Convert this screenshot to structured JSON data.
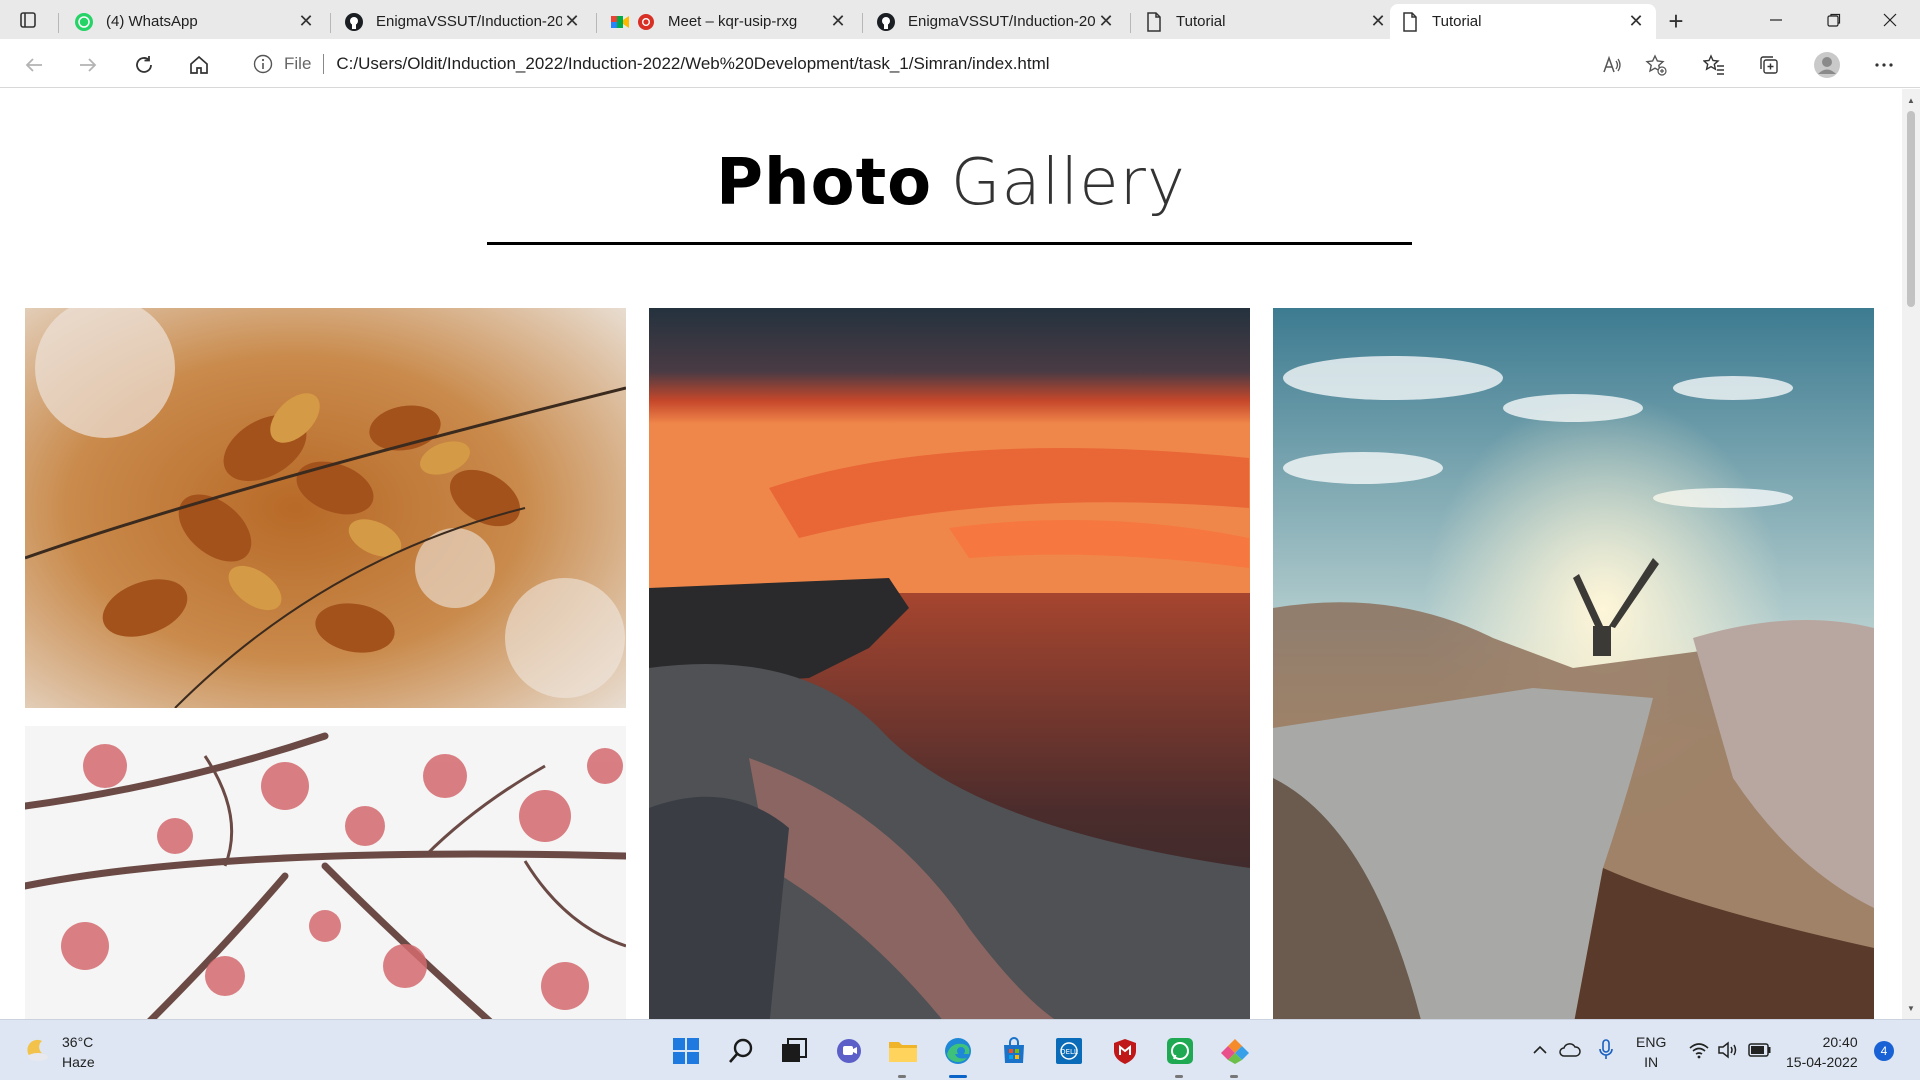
{
  "browser": {
    "tabs": [
      {
        "title": "(4) WhatsApp",
        "icon": "whatsapp-icon"
      },
      {
        "title": "EnigmaVSSUT/Induction-20",
        "icon": "github-icon"
      },
      {
        "title": "Meet – kqr-usip-rxg",
        "icon": "google-meet-icon"
      },
      {
        "title": "EnigmaVSSUT/Induction-20",
        "icon": "github-icon"
      },
      {
        "title": "Tutorial",
        "icon": "document-icon"
      },
      {
        "title": "Tutorial",
        "icon": "document-icon",
        "active": true
      }
    ],
    "address": {
      "scheme_label": "File",
      "url": "C:/Users/Oldit/Induction_2022/Induction-2022/Web%20Development/task_1/Simran/index.html"
    }
  },
  "page": {
    "heading_bold": "Photo",
    "heading_light": "Gallery",
    "photos": [
      {
        "subject": "autumn leaves"
      },
      {
        "subject": "sunset over sea cliffs"
      },
      {
        "subject": "handstand on cliff edge"
      },
      {
        "subject": "pink blossom branches"
      }
    ]
  },
  "taskbar": {
    "weather_temp": "36°C",
    "weather_desc": "Haze",
    "lang_top": "ENG",
    "lang_bottom": "IN",
    "time": "20:40",
    "date": "15-04-2022",
    "notification_count": "4"
  },
  "colors": {
    "tabstrip_bg": "#e9e9ea",
    "taskbar_bg": "#dde6f2",
    "accent": "#0a64c8"
  }
}
